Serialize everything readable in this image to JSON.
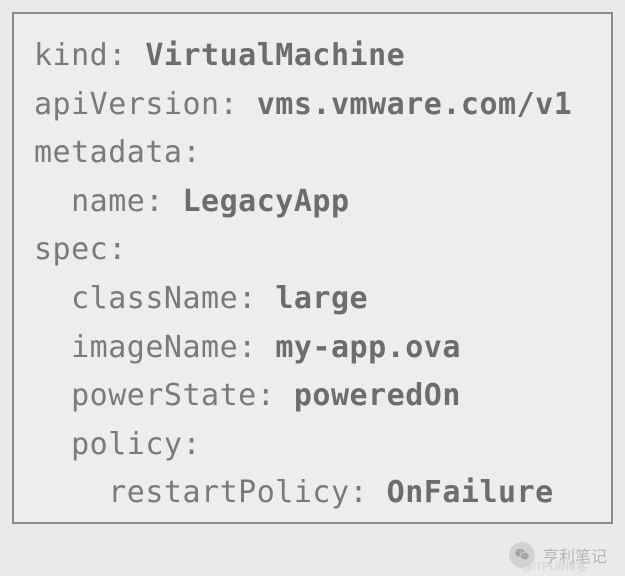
{
  "yaml": {
    "kind": {
      "key": "kind: ",
      "value": "VirtualMachine"
    },
    "apiVersion": {
      "key": "apiVersion: ",
      "value": "vms.vmware.com/v1"
    },
    "metadata": {
      "key": "metadata:",
      "value": ""
    },
    "meta_name": {
      "key": "  name: ",
      "value": "LegacyApp"
    },
    "spec": {
      "key": "spec:",
      "value": ""
    },
    "className": {
      "key": "  className: ",
      "value": "large"
    },
    "imageName": {
      "key": "  imageName: ",
      "value": "my-app.ova"
    },
    "powerState": {
      "key": "  powerState: ",
      "value": "poweredOn"
    },
    "policy": {
      "key": "  policy:",
      "value": ""
    },
    "restart": {
      "key": "    restartPolicy: ",
      "value": "OnFailure"
    }
  },
  "watermark": {
    "text": "亨利笔记",
    "sub": "@ITPUB博客"
  }
}
